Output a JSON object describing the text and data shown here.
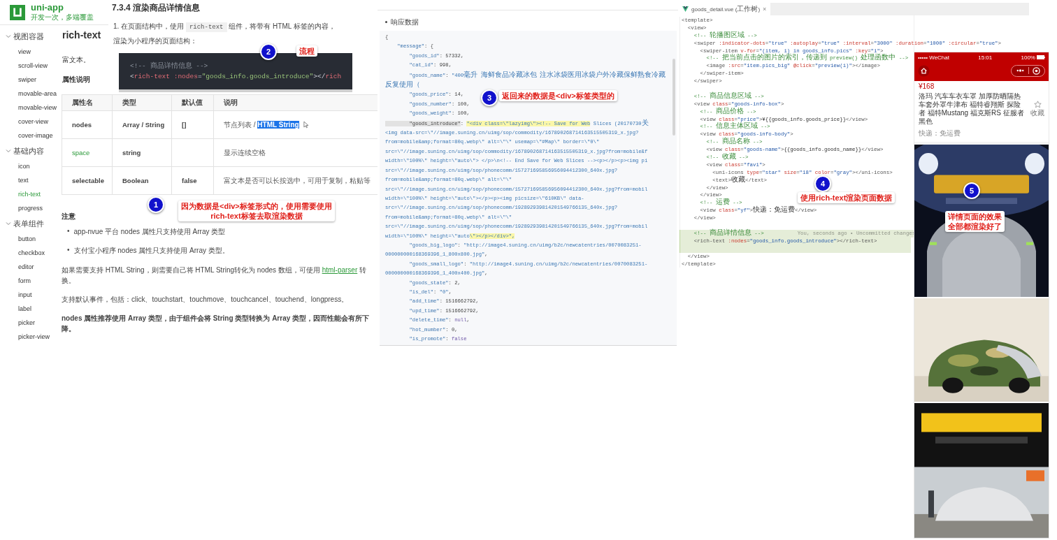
{
  "docs": {
    "logo": {
      "name": "uni-app",
      "slogan": "开发一次，多端覆盖"
    },
    "nav": [
      {
        "label": "视图容器",
        "expanded": true,
        "children": [
          {
            "label": "view",
            "selected": false
          },
          {
            "label": "scroll-view",
            "selected": false
          },
          {
            "label": "swiper",
            "selected": false
          },
          {
            "label": "movable-area",
            "selected": false
          },
          {
            "label": "movable-view",
            "selected": false
          },
          {
            "label": "cover-view",
            "selected": false
          },
          {
            "label": "cover-image",
            "selected": false
          }
        ]
      },
      {
        "label": "基础内容",
        "expanded": true,
        "children": [
          {
            "label": "icon",
            "selected": false
          },
          {
            "label": "text",
            "selected": false
          },
          {
            "label": "rich-text",
            "selected": true
          },
          {
            "label": "progress",
            "selected": false
          }
        ]
      },
      {
        "label": "表单组件",
        "expanded": true,
        "children": [
          {
            "label": "button",
            "selected": false
          },
          {
            "label": "checkbox",
            "selected": false
          },
          {
            "label": "editor",
            "selected": false
          },
          {
            "label": "form",
            "selected": false
          },
          {
            "label": "input",
            "selected": false
          },
          {
            "label": "label",
            "selected": false
          },
          {
            "label": "picker",
            "selected": false
          },
          {
            "label": "picker-view",
            "selected": false
          }
        ]
      }
    ],
    "page_title": "rich-text",
    "intro": "富文本。",
    "props_heading": "属性说明",
    "section_heading": "7.3.4 渲染商品详情信息",
    "step": {
      "number": "1.",
      "before": "在页面结构中，使用",
      "code": "rich-text",
      "after": "组件，将带有 HTML 标签的内容，渲染为小程序的页面结构："
    },
    "code_lines": [
      [
        {
          "kind": "comment",
          "t": "<!-- 商品详情信息 -->"
        }
      ],
      [
        {
          "kind": "punct",
          "t": "<"
        },
        {
          "kind": "tag",
          "t": "rich-text"
        },
        {
          "kind": "attr",
          "t": " :nodes"
        },
        {
          "kind": "punct",
          "t": "="
        },
        {
          "kind": "str",
          "t": "\"goods_info.goods_introduce\""
        },
        {
          "kind": "punct",
          "t": "></"
        },
        {
          "kind": "tag",
          "t": "rich"
        }
      ]
    ],
    "table": {
      "columns": [
        "属性名",
        "类型",
        "默认值",
        "说明"
      ],
      "rows": [
        {
          "name": "nodes",
          "link": false,
          "type": "Array / String",
          "default": "[]",
          "description": "节点列表 / ",
          "selected_text": "HTML String"
        },
        {
          "name": "space",
          "link": true,
          "type": "string",
          "description": "显示连续空格"
        },
        {
          "name": "selectable",
          "link": false,
          "type": "Boolean",
          "default": "false",
          "description": "富文本是否可以长按选中，可用于复制，粘贴等"
        }
      ]
    },
    "notes_heading": "注意",
    "bullets": [
      {
        "marker": "•",
        "text": "app-nvue 平台 nodes 属性只支持使用 Array 类型"
      },
      {
        "marker": "•",
        "text": "支付宝小程序 nodes 属性只支持使用 Array 类型。"
      }
    ],
    "parser_note": {
      "before": "如果需要支持 HTML String，则需要自己将 HTML String转化为 nodes 数组，可使用 ",
      "link": "html-parser",
      "after": " 转换。"
    },
    "events_note": "支持默认事件，包括：click、touchstart、touchmove、touchcancel、touchend、longpress。",
    "perf_note": "nodes 属性推荐使用 Array 类型，由于组件会将 String 类型转换为 Array 类型，因而性能会有所下降。"
  },
  "response": {
    "heading": "响应数据",
    "lines": [
      [
        {
          "kind": "punct",
          "t": "{"
        }
      ],
      [
        {
          "kind": "key",
          "t": "    \"message\""
        },
        {
          "kind": "punct",
          "t": ": {"
        }
      ],
      [
        {
          "kind": "key",
          "t": "        \"goods_id\""
        },
        {
          "kind": "punct",
          "t": ": "
        },
        {
          "kind": "num",
          "t": "57332"
        },
        {
          "kind": "punct",
          "t": ","
        }
      ],
      [
        {
          "kind": "key",
          "t": "        \"cat_id\""
        },
        {
          "kind": "punct",
          "t": ": "
        },
        {
          "kind": "num",
          "t": "998"
        },
        {
          "kind": "punct",
          "t": ","
        }
      ],
      [
        {
          "kind": "key",
          "t": "        \"goods_name\""
        },
        {
          "kind": "punct",
          "t": ": "
        },
        {
          "kind": "str",
          "t": "\"400毫升 海鲜食品冷藏冰包 注水冰袋医用冰袋户外冷藏保鲜熟食冷藏反复使用（"
        }
      ],
      [
        {
          "kind": "key",
          "t": "        \"goods_price\""
        },
        {
          "kind": "punct",
          "t": ": "
        },
        {
          "kind": "num",
          "t": "14"
        },
        {
          "kind": "punct",
          "t": ","
        }
      ],
      [
        {
          "kind": "key",
          "t": "        \"goods_number\""
        },
        {
          "kind": "punct",
          "t": ": "
        },
        {
          "kind": "num",
          "t": "100"
        },
        {
          "kind": "punct",
          "t": ","
        }
      ],
      [
        {
          "kind": "key",
          "t": "        \"goods_weight\""
        },
        {
          "kind": "punct",
          "t": ": "
        },
        {
          "kind": "num",
          "t": "100"
        },
        {
          "kind": "punct",
          "t": ","
        }
      ],
      [
        {
          "kind": "key_hl",
          "t": "        \"goods_introduce\""
        },
        {
          "kind": "punct",
          "t": ": "
        },
        {
          "kind": "str_hl",
          "t": "\"<div class=\\\"lazyimg\\\"><!-- Save for Web"
        },
        {
          "kind": "str",
          "t": " Slices (20170730关"
        }
      ],
      [
        {
          "kind": "str",
          "t": "<img data-src=\\\"//image.suning.cn/uimg/sop/commodity/167890268714163515505319_x.jpg?"
        }
      ],
      [
        {
          "kind": "str",
          "t": "from=mobile&amp;format=80q.webp\\\" alt=\\\"\\\" usemap=\\\"#Map\\\" border=\\\"0\\\""
        }
      ],
      [
        {
          "kind": "str",
          "t": "src=\\\"//image.suning.cn/uimg/sop/commodity/167890268714163515505319_x.jpg?from=mobile&f"
        }
      ],
      [
        {
          "kind": "str",
          "t": "width=\\\"100%\\\" height=\\\"auto\\\"> </p>\\n<!-- End Save for Web Slices --><p></p><p><img pi"
        }
      ],
      [
        {
          "kind": "str",
          "t": "src=\\\"//image.suning.cn/uimg/sop/phonecomm/157271695856956094412300_640x.jpg?"
        }
      ],
      [
        {
          "kind": "str",
          "t": "from=mobile&amp;format=80q.webp\\\" alt=\\\"\\\""
        }
      ],
      [
        {
          "kind": "str",
          "t": "src=\\\"//image.suning.cn/uimg/sop/phonecomm/157271695856956094412300_640x.jpg?from=mobil"
        }
      ],
      [
        {
          "kind": "str",
          "t": "width=\\\"100%\\\" height=\\\"auto\\\"></p><p><img picsize=\\\"610KB\\\" data-"
        }
      ],
      [
        {
          "kind": "str",
          "t": "src=\\\"//image.suning.cn/uimg/sop/phonecomm/192892939814201549766135_640x.jpg?"
        }
      ],
      [
        {
          "kind": "str",
          "t": "from=mobile&amp;format=80q.webp\\\" alt=\\\"\\\""
        }
      ],
      [
        {
          "kind": "str",
          "t": "src=\\\"//image.suning.cn/uimg/sop/phonecomm/192892939814201549766135_640x.jpg?from=mobil"
        }
      ],
      [
        {
          "kind": "str",
          "t": "width=\\\"100%\\\" height=\\\"auto"
        },
        {
          "kind": "str_hl",
          "t": "\\\"></p></div>\","
        }
      ],
      [
        {
          "kind": "key",
          "t": "        \"goods_big_logo\""
        },
        {
          "kind": "punct",
          "t": ": "
        },
        {
          "kind": "str",
          "t": "\"http://image4.suning.cn/uimg/b2c/newcatentries/0070083251-"
        }
      ],
      [
        {
          "kind": "str",
          "t": "000000000168369396_1_800x800.jpg\""
        },
        {
          "kind": "punct",
          "t": ","
        }
      ],
      [
        {
          "kind": "key",
          "t": "        \"goods_small_logo\""
        },
        {
          "kind": "punct",
          "t": ": "
        },
        {
          "kind": "str",
          "t": "\"http://image4.suning.cn/uimg/b2c/newcatentries/0070083251-"
        }
      ],
      [
        {
          "kind": "str",
          "t": "000000000168369396_1_400x400.jpg\""
        },
        {
          "kind": "punct",
          "t": ","
        }
      ],
      [
        {
          "kind": "key",
          "t": "        \"goods_state\""
        },
        {
          "kind": "punct",
          "t": ": "
        },
        {
          "kind": "num",
          "t": "2"
        },
        {
          "kind": "punct",
          "t": ","
        }
      ],
      [
        {
          "kind": "key",
          "t": "        \"is_del\""
        },
        {
          "kind": "punct",
          "t": ": "
        },
        {
          "kind": "str",
          "t": "\"0\""
        },
        {
          "kind": "punct",
          "t": ","
        }
      ],
      [
        {
          "kind": "key",
          "t": "        \"add_time\""
        },
        {
          "kind": "punct",
          "t": ": "
        },
        {
          "kind": "num",
          "t": "1516662792"
        },
        {
          "kind": "punct",
          "t": ","
        }
      ],
      [
        {
          "kind": "key",
          "t": "        \"upd_time\""
        },
        {
          "kind": "punct",
          "t": ": "
        },
        {
          "kind": "num",
          "t": "1516662792"
        },
        {
          "kind": "punct",
          "t": ","
        }
      ],
      [
        {
          "kind": "key",
          "t": "        \"delete_time\""
        },
        {
          "kind": "punct",
          "t": ": "
        },
        {
          "kind": "lit",
          "t": "null"
        },
        {
          "kind": "punct",
          "t": ","
        }
      ],
      [
        {
          "kind": "key",
          "t": "        \"hot_mumber\""
        },
        {
          "kind": "punct",
          "t": ": "
        },
        {
          "kind": "num",
          "t": "0"
        },
        {
          "kind": "punct",
          "t": ","
        }
      ],
      [
        {
          "kind": "key",
          "t": "        \"is_promote\""
        },
        {
          "kind": "punct",
          "t": ": "
        },
        {
          "kind": "lit",
          "t": "false"
        }
      ]
    ]
  },
  "editor": {
    "tab": {
      "label": "goods_detail.vue (工作树)",
      "close": "×"
    },
    "lines": [
      {
        "changed": false,
        "tokens": [
          {
            "kind": "tag",
            "t": "<template>"
          }
        ]
      },
      {
        "changed": false,
        "tokens": [
          {
            "kind": "tag",
            "t": "  <view>"
          }
        ]
      },
      {
        "changed": false,
        "tokens": [
          {
            "kind": "comment",
            "t": "    <!-- 轮播图区域 -->"
          }
        ]
      },
      {
        "changed": false,
        "tokens": [
          {
            "kind": "tag",
            "t": "    <swiper"
          },
          {
            "kind": "attr",
            "t": " :indicator-dots"
          },
          {
            "kind": "tag",
            "t": "="
          },
          {
            "kind": "str",
            "t": "\"true\""
          },
          {
            "kind": "attr",
            "t": " :autoplay"
          },
          {
            "kind": "tag",
            "t": "="
          },
          {
            "kind": "str",
            "t": "\"true\""
          },
          {
            "kind": "attr",
            "t": " :interval"
          },
          {
            "kind": "tag",
            "t": "="
          },
          {
            "kind": "str",
            "t": "\"3000\""
          },
          {
            "kind": "attr",
            "t": " :duration"
          },
          {
            "kind": "tag",
            "t": "="
          },
          {
            "kind": "str",
            "t": "\"1000\""
          },
          {
            "kind": "attr",
            "t": " :circular"
          },
          {
            "kind": "tag",
            "t": "="
          },
          {
            "kind": "str",
            "t": "\"true\""
          },
          {
            "kind": "tag",
            "t": ">"
          }
        ]
      },
      {
        "changed": false,
        "tokens": [
          {
            "kind": "tag",
            "t": "      <swiper-item"
          },
          {
            "kind": "attr",
            "t": " v-for"
          },
          {
            "kind": "tag",
            "t": "="
          },
          {
            "kind": "str",
            "t": "\"(item, i) in goods_info.pics\""
          },
          {
            "kind": "attr",
            "t": " :key"
          },
          {
            "kind": "tag",
            "t": "="
          },
          {
            "kind": "str",
            "t": "\"i\""
          },
          {
            "kind": "tag",
            "t": ">"
          }
        ]
      },
      {
        "changed": false,
        "tokens": [
          {
            "kind": "comment",
            "t": "        <!-- 把当前点击的图片的索引，传递到 preview() 处理函数中 -->"
          }
        ]
      },
      {
        "changed": false,
        "tokens": [
          {
            "kind": "tag",
            "t": "        <image"
          },
          {
            "kind": "attr",
            "t": " :src"
          },
          {
            "kind": "tag",
            "t": "="
          },
          {
            "kind": "str",
            "t": "\"item.pics_big\""
          },
          {
            "kind": "attr",
            "t": " @click"
          },
          {
            "kind": "tag",
            "t": "="
          },
          {
            "kind": "str",
            "t": "\"preview(i)\""
          },
          {
            "kind": "tag",
            "t": "></image>"
          }
        ]
      },
      {
        "changed": false,
        "tokens": [
          {
            "kind": "tag",
            "t": "      </swiper-item>"
          }
        ]
      },
      {
        "changed": false,
        "tokens": [
          {
            "kind": "tag",
            "t": "    </swiper>"
          }
        ]
      },
      {
        "changed": false
      },
      {
        "changed": false,
        "tokens": [
          {
            "kind": "comment",
            "t": "    <!-- 商品信息区域 -->"
          }
        ]
      },
      {
        "changed": false,
        "tokens": [
          {
            "kind": "tag",
            "t": "    <view"
          },
          {
            "kind": "attr",
            "t": " class"
          },
          {
            "kind": "tag",
            "t": "="
          },
          {
            "kind": "str",
            "t": "\"goods-info-box\""
          },
          {
            "kind": "tag",
            "t": ">"
          }
        ]
      },
      {
        "changed": false,
        "tokens": [
          {
            "kind": "comment",
            "t": "      <!-- 商品价格 -->"
          }
        ]
      },
      {
        "changed": false,
        "tokens": [
          {
            "kind": "tag",
            "t": "      <view"
          },
          {
            "kind": "attr",
            "t": " class"
          },
          {
            "kind": "tag",
            "t": "="
          },
          {
            "kind": "str",
            "t": "\"price\""
          },
          {
            "kind": "tag",
            "t": ">"
          },
          {
            "kind": "text",
            "t": "¥{{goods_info.goods_price}}"
          },
          {
            "kind": "tag",
            "t": "</view>"
          }
        ]
      },
      {
        "changed": false,
        "tokens": [
          {
            "kind": "comment",
            "t": "      <!-- 信息主体区域 -->"
          }
        ]
      },
      {
        "changed": false,
        "tokens": [
          {
            "kind": "tag",
            "t": "      <view"
          },
          {
            "kind": "attr",
            "t": " class"
          },
          {
            "kind": "tag",
            "t": "="
          },
          {
            "kind": "str",
            "t": "\"goods-info-body\""
          },
          {
            "kind": "tag",
            "t": ">"
          }
        ]
      },
      {
        "changed": false,
        "tokens": [
          {
            "kind": "comment",
            "t": "        <!-- 商品名称 -->"
          }
        ]
      },
      {
        "changed": false,
        "tokens": [
          {
            "kind": "tag",
            "t": "        <view"
          },
          {
            "kind": "attr",
            "t": " class"
          },
          {
            "kind": "tag",
            "t": "="
          },
          {
            "kind": "str",
            "t": "\"goods-name\""
          },
          {
            "kind": "tag",
            "t": ">"
          },
          {
            "kind": "text",
            "t": "{{goods_info.goods_name}}"
          },
          {
            "kind": "tag",
            "t": "</view>"
          }
        ]
      },
      {
        "changed": false,
        "tokens": [
          {
            "kind": "comment",
            "t": "        <!-- 收藏 -->"
          }
        ]
      },
      {
        "changed": false,
        "tokens": [
          {
            "kind": "tag",
            "t": "        <view"
          },
          {
            "kind": "attr",
            "t": " class"
          },
          {
            "kind": "tag",
            "t": "="
          },
          {
            "kind": "str",
            "t": "\"favi\""
          },
          {
            "kind": "tag",
            "t": ">"
          }
        ]
      },
      {
        "changed": false,
        "tokens": [
          {
            "kind": "tag",
            "t": "          <uni-icons"
          },
          {
            "kind": "attr",
            "t": " type"
          },
          {
            "kind": "tag",
            "t": "="
          },
          {
            "kind": "str",
            "t": "\"star\""
          },
          {
            "kind": "attr",
            "t": " size"
          },
          {
            "kind": "tag",
            "t": "="
          },
          {
            "kind": "str",
            "t": "\"18\""
          },
          {
            "kind": "attr",
            "t": " color"
          },
          {
            "kind": "tag",
            "t": "="
          },
          {
            "kind": "str",
            "t": "\"gray\""
          },
          {
            "kind": "tag",
            "t": "></uni-icons>"
          }
        ]
      },
      {
        "changed": false,
        "tokens": [
          {
            "kind": "tag",
            "t": "          <text>"
          },
          {
            "kind": "text",
            "t": "收藏"
          },
          {
            "kind": "tag",
            "t": "</text>"
          }
        ]
      },
      {
        "changed": false,
        "tokens": [
          {
            "kind": "tag",
            "t": "        </view>"
          }
        ]
      },
      {
        "changed": false,
        "tokens": [
          {
            "kind": "tag",
            "t": "      </view>"
          }
        ]
      },
      {
        "changed": false,
        "tokens": [
          {
            "kind": "comment",
            "t": "      <!-- 运费 -->"
          }
        ]
      },
      {
        "changed": false,
        "tokens": [
          {
            "kind": "tag",
            "t": "      <view"
          },
          {
            "kind": "attr",
            "t": " class"
          },
          {
            "kind": "tag",
            "t": "="
          },
          {
            "kind": "str",
            "t": "\"yf\""
          },
          {
            "kind": "tag",
            "t": ">"
          },
          {
            "kind": "text",
            "t": "快递：免运费"
          },
          {
            "kind": "tag",
            "t": "</view>"
          }
        ]
      },
      {
        "changed": false,
        "tokens": [
          {
            "kind": "tag",
            "t": "    </view>"
          }
        ]
      },
      {
        "changed": false
      },
      {
        "changed": true,
        "tokens": [
          {
            "kind": "comment",
            "t": "    <!-- 商品详情信息 -->"
          },
          {
            "kind": "ghost",
            "t": "You, seconds ago • Uncommitted changes"
          }
        ]
      },
      {
        "changed": true,
        "tokens": [
          {
            "kind": "tag",
            "t": "    <rich-text"
          },
          {
            "kind": "attr",
            "t": " :nodes"
          },
          {
            "kind": "tag",
            "t": "="
          },
          {
            "kind": "str",
            "t": "\"goods_info.goods_introduce\""
          },
          {
            "kind": "tag",
            "t": "></rich-text>"
          }
        ]
      },
      {
        "changed": true
      },
      {
        "changed": false,
        "tokens": [
          {
            "kind": "tag",
            "t": "  </view>"
          }
        ]
      },
      {
        "changed": false,
        "tokens": [
          {
            "kind": "tag",
            "t": "</template>"
          }
        ]
      }
    ]
  },
  "phone": {
    "carrier": "••••• WeChat",
    "time": "15:01",
    "battery": "100%",
    "price": "¥168",
    "goods_name": "洛玛 汽车车衣车罩 加厚防晒隔热车套外罩牛津布 福特睿翔斯 探险者 福特Mustang 福克斯RS 征服者黑色",
    "favorite_label": "收藏",
    "shipping": "快递：免运费"
  },
  "annotations": [
    {
      "number": "2",
      "lines": [
        "流程"
      ]
    },
    {
      "number": "3",
      "lines": [
        "返回来的数据是<div>标签类型的"
      ]
    },
    {
      "number": "1",
      "lines": [
        "因为数据是<div>标签形式的，使用需要使用",
        "rich-text标签去取渲染数据"
      ]
    },
    {
      "number": "4",
      "lines": [
        "使用rich-text渲染页面数据"
      ]
    },
    {
      "number": "5",
      "lines": [
        "详情页面的效果",
        "全部都渲染好了"
      ]
    }
  ]
}
